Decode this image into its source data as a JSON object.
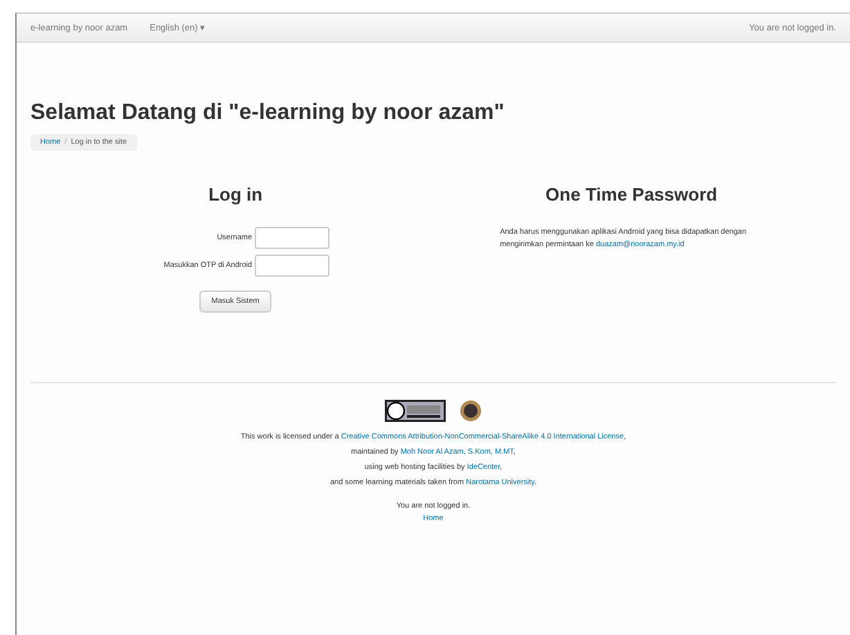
{
  "navbar": {
    "brand": "e-learning by noor azam",
    "language": "English (en) ▾",
    "login_info": "You are not logged in."
  },
  "page_title": "Selamat Datang di \"e-learning by noor azam\"",
  "breadcrumb": [
    {
      "label": "Home",
      "kind": "link"
    },
    {
      "label": "/",
      "kind": "separator"
    },
    {
      "label": "Log in to the site",
      "kind": "text"
    }
  ],
  "login": {
    "heading": "Log in",
    "fields": [
      {
        "label": "Username"
      },
      {
        "label": "Masukkan OTP di Android"
      }
    ],
    "button": "Masuk Sistem"
  },
  "otp": {
    "heading": "One Time Password",
    "text": [
      {
        "kind": "text",
        "text": "Anda harus menggunakan aplikasi Android yang bisa didapatkan dengan mengirimkan permintaan ke "
      },
      {
        "kind": "link",
        "text": "duazam@noorazam.my.id"
      }
    ]
  },
  "footer": {
    "lines": [
      [
        {
          "kind": "text",
          "text": "This work is licensed under a "
        },
        {
          "kind": "link",
          "text": "Creative Commons Attribution-NonCommercial-ShareAlike 4.0 International License"
        },
        {
          "kind": "text",
          "text": ","
        }
      ],
      [
        {
          "kind": "text",
          "text": "maintained by "
        },
        {
          "kind": "link",
          "text": "Moh Noor Al Azam, S.Kom, M.MT"
        },
        {
          "kind": "text",
          "text": ","
        }
      ],
      [
        {
          "kind": "text",
          "text": "using web hosting facilities by "
        },
        {
          "kind": "link",
          "text": "IdeCenter"
        },
        {
          "kind": "text",
          "text": ","
        }
      ],
      [
        {
          "kind": "text",
          "text": "and some learning materials taken from "
        },
        {
          "kind": "link",
          "text": "Narotama University"
        },
        {
          "kind": "text",
          "text": "."
        }
      ]
    ],
    "login_info": "You are not logged in.",
    "home_link": "Home"
  }
}
